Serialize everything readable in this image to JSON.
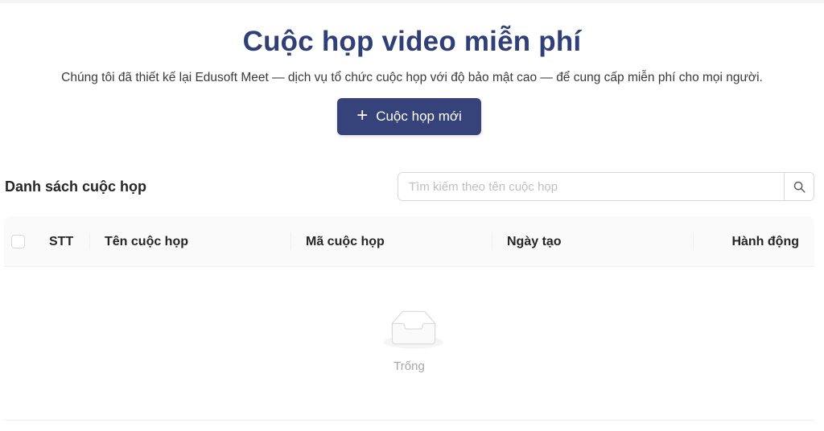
{
  "hero": {
    "title": "Cuộc họp video miễn phí",
    "subtitle": "Chúng tôi đã thiết kế lại Edusoft Meet — dịch vụ tổ chức cuộc họp với độ bảo mật cao — để cung cấp miễn phí cho mọi người.",
    "new_meeting_label": "Cuộc họp mới"
  },
  "list": {
    "title": "Danh sách cuộc họp",
    "search": {
      "placeholder": "Tìm kiếm theo tên cuộc họp",
      "value": ""
    }
  },
  "table": {
    "columns": [
      "STT",
      "Tên cuộc họp",
      "Mã cuộc họp",
      "Ngày tạo",
      "Hành động"
    ],
    "rows": [],
    "empty_text": "Trống"
  },
  "colors": {
    "primary": "#36427a",
    "title": "#2f3f7c"
  },
  "icons": {
    "new_meeting": "plus-icon",
    "search": "search-icon",
    "empty": "empty-inbox-icon"
  }
}
